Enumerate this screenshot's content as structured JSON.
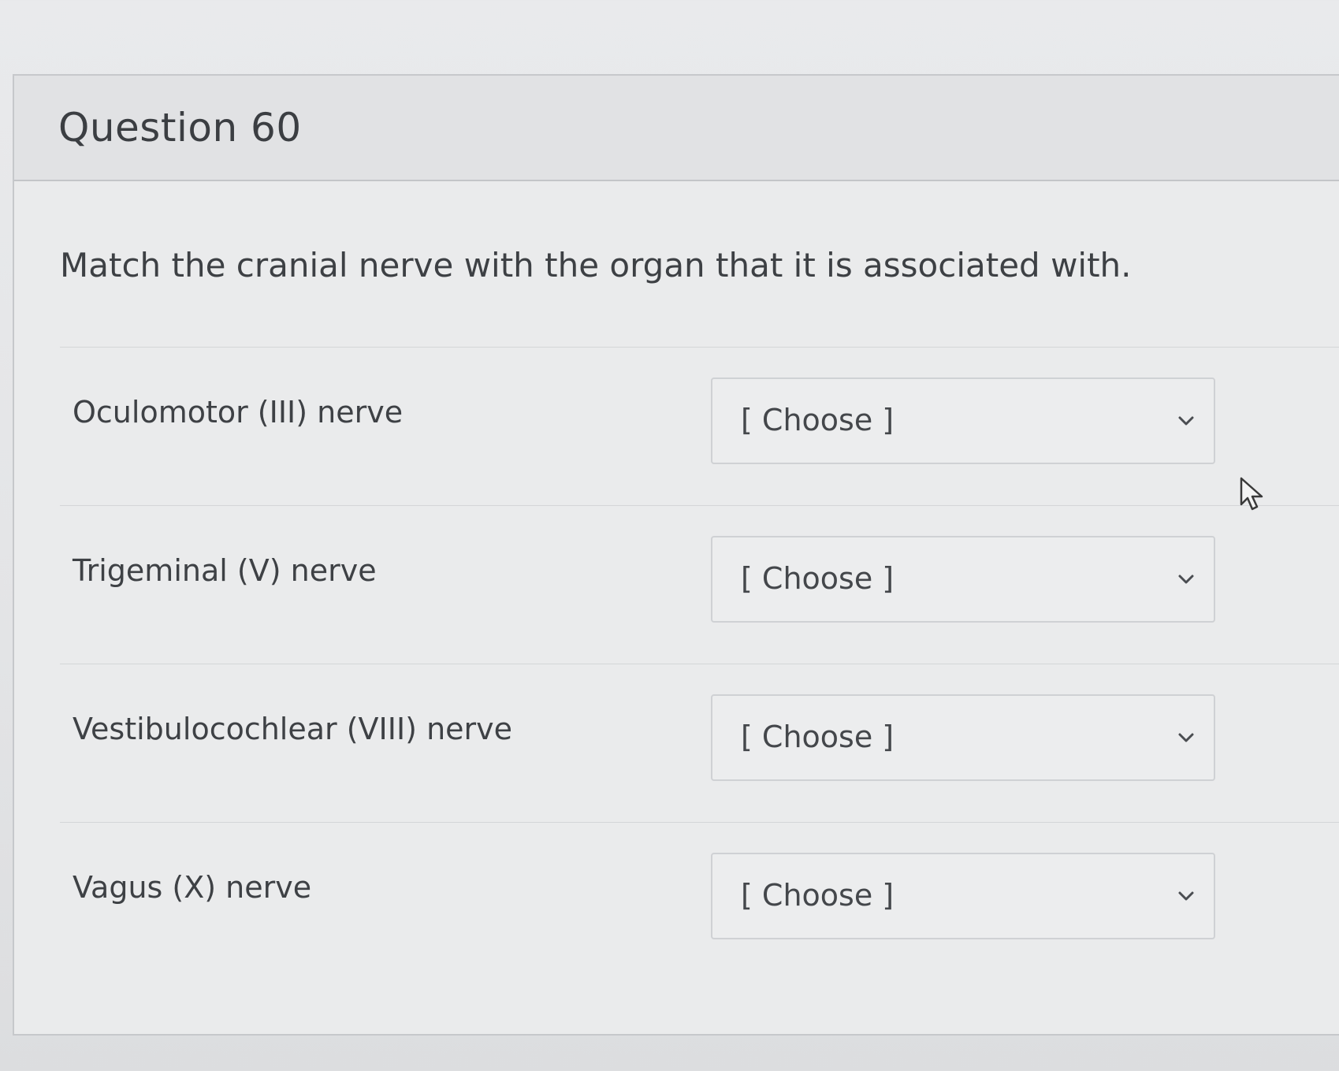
{
  "question": {
    "title": "Question 60",
    "prompt": "Match the cranial nerve with the organ that it is associated with."
  },
  "matches": [
    {
      "label": "Oculomotor (III) nerve",
      "selected": "[ Choose ]"
    },
    {
      "label": "Trigeminal (V) nerve",
      "selected": "[ Choose ]"
    },
    {
      "label": "Vestibulocochlear (VIII) nerve",
      "selected": "[ Choose ]"
    },
    {
      "label": "Vagus (X) nerve",
      "selected": "[ Choose ]"
    }
  ],
  "icons": {
    "dropdown": "chevron-down-icon",
    "pointer": "mouse-cursor-icon"
  },
  "colors": {
    "background": "#e6e7e9",
    "header_background": "#e1e2e4",
    "text": "#3b3e42",
    "border": "#c6c8cb"
  }
}
